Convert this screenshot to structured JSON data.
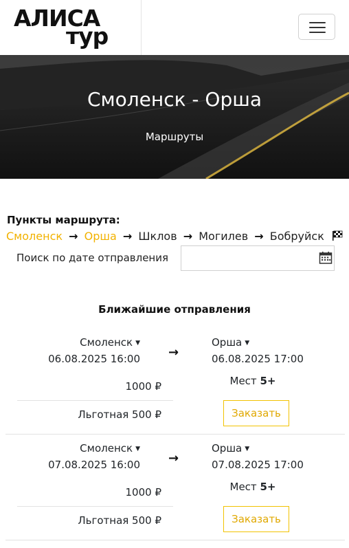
{
  "header": {
    "logo_line1": "АЛИСА",
    "logo_line2": "тур"
  },
  "hero": {
    "title": "Смоленск - Орша",
    "subtitle": "Маршруты"
  },
  "route": {
    "title": "Пункты маршрута:",
    "stops": [
      "Смоленск",
      "Орша",
      "Шклов",
      "Могилев",
      "Бобруйск"
    ],
    "active_stops": [
      "Смоленск",
      "Орша"
    ]
  },
  "date_search": {
    "label": "Поиск по дате отправления",
    "value": "",
    "placeholder": ""
  },
  "departures": {
    "title": "Ближайшие отправления",
    "trips": [
      {
        "from_city": "Смоленск",
        "from_datetime": "06.08.2025 16:00",
        "to_city": "Орша",
        "to_datetime": "06.08.2025 17:00",
        "price": "1000 ₽",
        "discount_price": "Льготная 500 ₽",
        "seats_label": "Мест",
        "seats_value": "5+",
        "order_label": "Заказать"
      },
      {
        "from_city": "Смоленск",
        "from_datetime": "07.08.2025 16:00",
        "to_city": "Орша",
        "to_datetime": "07.08.2025 17:00",
        "price": "1000 ₽",
        "discount_price": "Льготная 500 ₽",
        "seats_label": "Мест",
        "seats_value": "5+",
        "order_label": "Заказать"
      }
    ]
  },
  "colors": {
    "accent": "#f2b200",
    "text": "#212529",
    "divider": "#e2e2e2"
  },
  "icons": [
    "hamburger-menu-icon",
    "arrow-right-icon",
    "finish-flag-icon",
    "calendar-icon",
    "caret-down-icon"
  ]
}
